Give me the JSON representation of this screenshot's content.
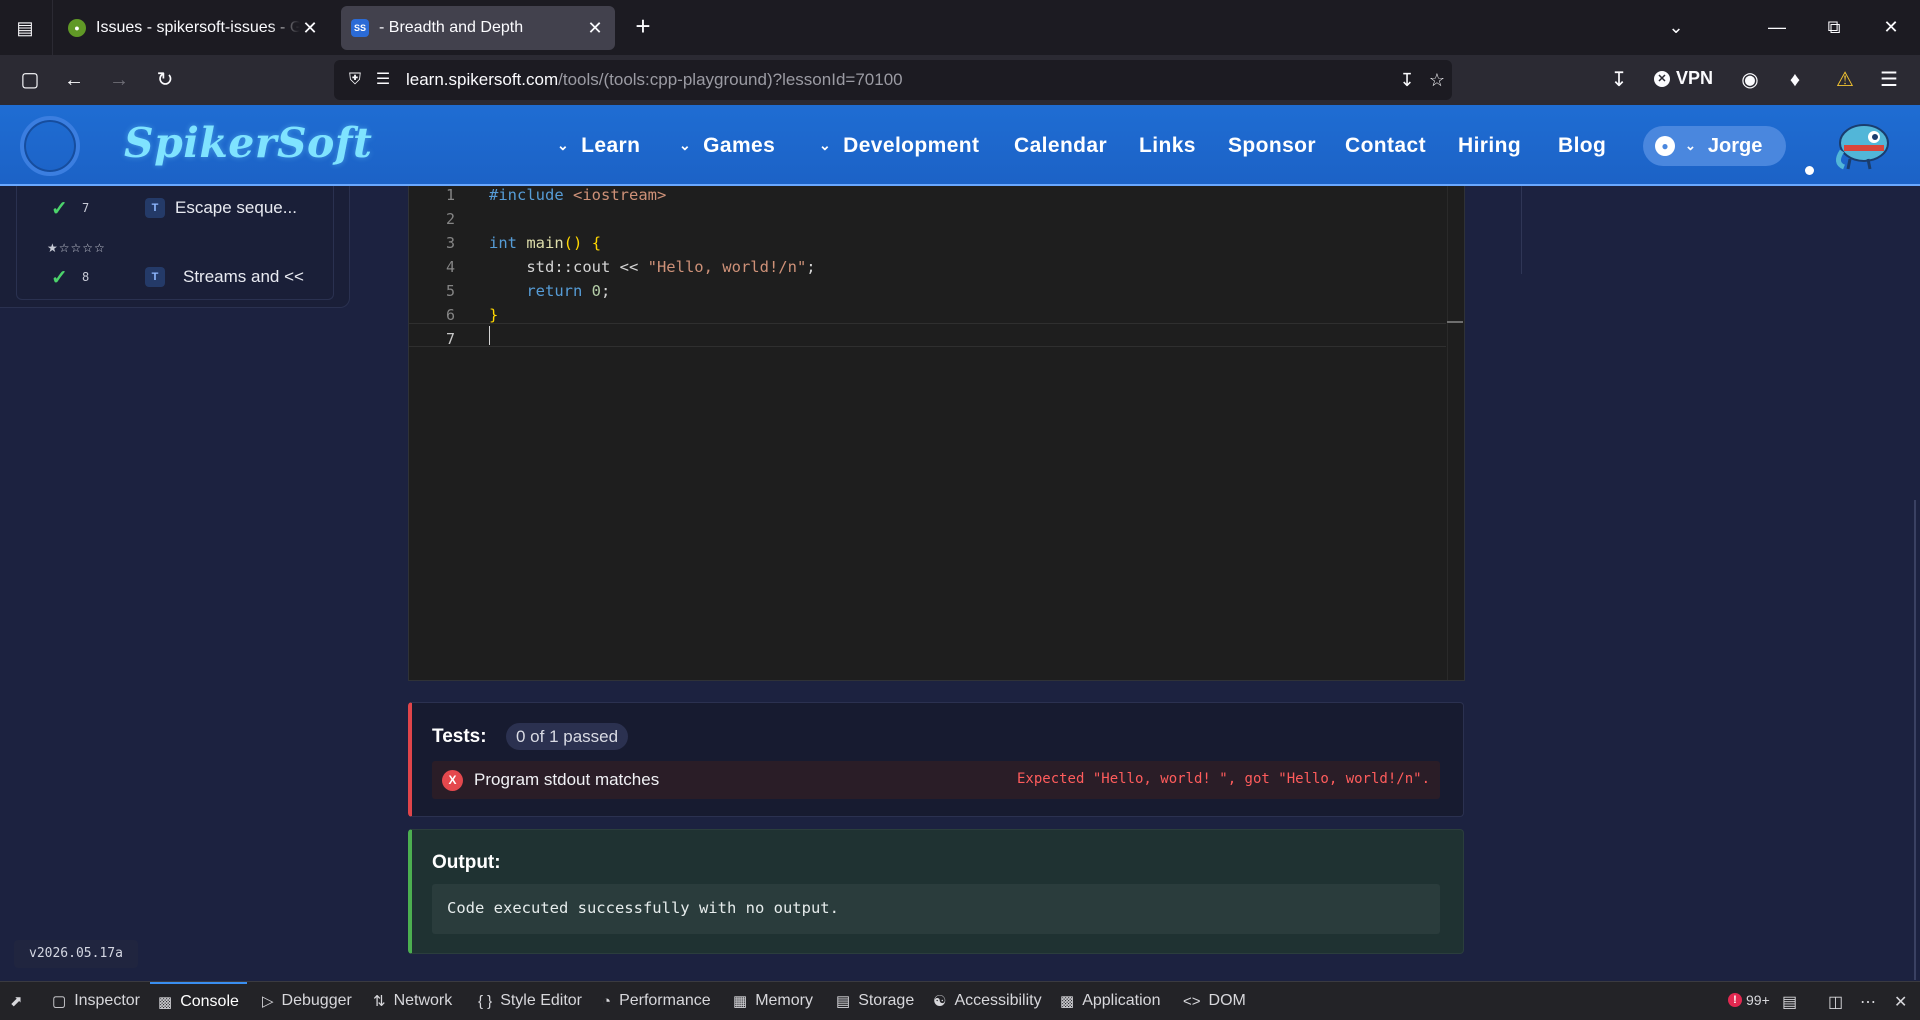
{
  "browser": {
    "tabs": [
      {
        "title": "Issues - spikersoft-issues - Gitea",
        "active": false
      },
      {
        "title": "- Breadth and Depth",
        "active": true
      }
    ],
    "url_host": "learn.spikersoft.com",
    "url_path": "/tools/(tools:cpp-playground)?lessonId=70100",
    "vpn_label": "VPN"
  },
  "site": {
    "brand": "SpikerSoft",
    "nav": [
      {
        "label": "Learn",
        "dropdown": true
      },
      {
        "label": "Games",
        "dropdown": true
      },
      {
        "label": "Development",
        "dropdown": true
      },
      {
        "label": "Calendar",
        "dropdown": false
      },
      {
        "label": "Links",
        "dropdown": false
      },
      {
        "label": "Sponsor",
        "dropdown": false
      },
      {
        "label": "Contact",
        "dropdown": false
      },
      {
        "label": "Hiring",
        "dropdown": false
      },
      {
        "label": "Blog",
        "dropdown": false
      }
    ],
    "user": "Jorge"
  },
  "lessons": [
    {
      "number": "7",
      "type": "T",
      "title": "Escape seque...",
      "completed": true,
      "stars": "★☆☆☆☆"
    },
    {
      "number": "8",
      "type": "T",
      "title": "Streams and <<",
      "completed": true
    }
  ],
  "editor": {
    "line_numbers": [
      "1",
      "2",
      "3",
      "4",
      "5",
      "6",
      "7"
    ],
    "lines": [
      "#include <iostream>",
      "",
      "int main() {",
      "    std::cout << \"Hello, world!/n\";",
      "    return 0;",
      "}",
      ""
    ]
  },
  "tests": {
    "heading": "Tests:",
    "summary": "0 of 1 passed",
    "results": [
      {
        "name": "Program stdout matches",
        "status_glyph": "X",
        "message": "Expected \"Hello, world! \", got \"Hello, world!/n\"."
      }
    ]
  },
  "output": {
    "heading": "Output:",
    "text": "Code executed successfully with no output."
  },
  "version": "v2026.05.17a",
  "devtools": {
    "tabs": [
      "Inspector",
      "Console",
      "Debugger",
      "Network",
      "Style Editor",
      "Performance",
      "Memory",
      "Storage",
      "Accessibility",
      "Application",
      "DOM"
    ],
    "selected": "Console",
    "error_count": "99+"
  },
  "colors": {
    "header_blue": "#1f6dd3",
    "brand_cyan": "#7fe3ff",
    "fail_red": "#e0454a",
    "pass_green": "#4caf50"
  }
}
